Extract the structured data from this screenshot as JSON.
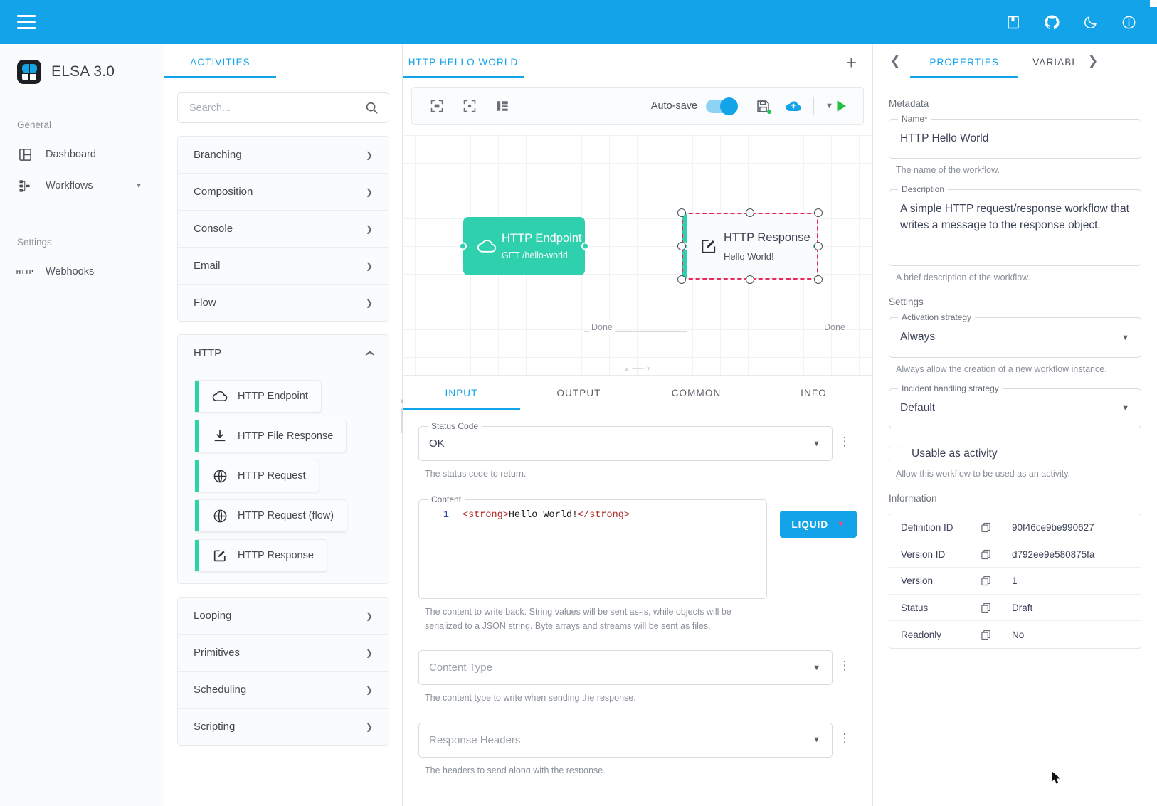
{
  "topbar": {
    "menu_icon": "hamburger-icon",
    "icons": [
      {
        "name": "docs-book-icon",
        "label": "Docs"
      },
      {
        "name": "github-icon",
        "label": "GitHub"
      },
      {
        "name": "dark-mode-moon-icon",
        "label": "Dark mode"
      },
      {
        "name": "info-icon",
        "label": "Info"
      }
    ]
  },
  "sidebar": {
    "brand": "ELSA 3.0",
    "sections": [
      {
        "title": "General",
        "items": [
          {
            "label": "Dashboard",
            "icon": "dashboard-icon",
            "caret": false
          },
          {
            "label": "Workflows",
            "icon": "workflows-icon",
            "caret": true
          }
        ]
      },
      {
        "title": "Settings",
        "items": [
          {
            "label": "Webhooks",
            "icon": "http-badge-icon",
            "caret": false
          }
        ]
      }
    ]
  },
  "activities_panel": {
    "tab": "ACTIVITIES",
    "search": {
      "value": "",
      "placeholder": "Search...",
      "icon": "search-icon"
    },
    "groups": [
      {
        "name": "Branching",
        "expanded": false
      },
      {
        "name": "Composition",
        "expanded": false
      },
      {
        "name": "Console",
        "expanded": false
      },
      {
        "name": "Email",
        "expanded": false
      },
      {
        "name": "Flow",
        "expanded": false
      },
      {
        "name": "HTTP",
        "expanded": true,
        "items": [
          {
            "label": "HTTP Endpoint",
            "icon": "cloud-icon"
          },
          {
            "label": "HTTP File Response",
            "icon": "download-icon"
          },
          {
            "label": "HTTP Request",
            "icon": "globe-icon"
          },
          {
            "label": "HTTP Request (flow)",
            "icon": "globe-icon"
          },
          {
            "label": "HTTP Response",
            "icon": "edit-square-icon"
          }
        ]
      },
      {
        "name": "Looping",
        "expanded": false
      },
      {
        "name": "Primitives",
        "expanded": false
      },
      {
        "name": "Scheduling",
        "expanded": false
      },
      {
        "name": "Scripting",
        "expanded": false
      }
    ]
  },
  "workflow": {
    "tab_label": "HTTP HELLO WORLD",
    "add_tab_icon": "plus-icon",
    "toolbar": {
      "zoom_to_fit_icon": "zoom-to-fit-icon",
      "center_icon": "center-canvas-icon",
      "layout_icon": "auto-layout-icon",
      "autosave_label": "Auto-save",
      "autosave_on": true,
      "save_icon": "save-disk-icon",
      "publish_icon": "publish-cloud-icon",
      "more_caret_icon": "chevron-down-icon",
      "run_icon": "run-play-icon"
    },
    "nodes": [
      {
        "title": "HTTP Endpoint",
        "subtitle": "GET /hello-world",
        "icon": "cloud-icon",
        "selected": false,
        "outcome": "Done"
      },
      {
        "title": "HTTP Response",
        "subtitle": "Hello World!",
        "icon": "edit-square-icon",
        "selected": true,
        "outcome": "Done"
      }
    ]
  },
  "detail": {
    "tabs": [
      {
        "label": "INPUT",
        "active": true
      },
      {
        "label": "OUTPUT",
        "active": false
      },
      {
        "label": "COMMON",
        "active": false
      },
      {
        "label": "INFO",
        "active": false
      }
    ],
    "status_code": {
      "legend": "Status Code",
      "value": "OK",
      "hint": "The status code to return."
    },
    "content": {
      "legend": "Content",
      "line_number": "1",
      "code_open_tag": "<strong>",
      "code_text": "Hello World!",
      "code_close_tag": "</strong>",
      "hint": "The content to write back. String values will be sent as-is, while objects will be serialized to a JSON string. Byte arrays and streams will be sent as files.",
      "syntax_button": "LIQUID"
    },
    "content_type": {
      "placeholder": "Content Type",
      "hint": "The content type to write when sending the response."
    },
    "response_headers": {
      "placeholder": "Response Headers",
      "hint": "The headers to send along with the response."
    }
  },
  "properties": {
    "tabs": [
      {
        "label": "PROPERTIES",
        "active": true
      },
      {
        "label": "VARIABL",
        "active": false
      }
    ],
    "prev_icon": "chevron-left-icon",
    "next_icon": "chevron-right-icon",
    "metadata_heading": "Metadata",
    "name": {
      "legend": "Name*",
      "value": "HTTP Hello World",
      "hint": "The name of the workflow."
    },
    "description": {
      "legend": "Description",
      "value": "A simple HTTP request/response workflow that writes a message to the response object.",
      "hint": "A brief description of the workflow."
    },
    "settings_heading": "Settings",
    "activation_strategy": {
      "legend": "Activation strategy",
      "value": "Always",
      "hint": "Always allow the creation of a new workflow instance."
    },
    "incident_strategy": {
      "legend": "Incident handling strategy",
      "value": "Default"
    },
    "usable_as_activity": {
      "label": "Usable as activity",
      "checked": false,
      "hint": "Allow this workflow to be used as an activity."
    },
    "information_heading": "Information",
    "information_rows": [
      {
        "key": "Definition ID",
        "value": "90f46ce9be990627",
        "copy_icon": "copy-icon"
      },
      {
        "key": "Version ID",
        "value": "d792ee9e580875fa",
        "copy_icon": "copy-icon"
      },
      {
        "key": "Version",
        "value": "1",
        "copy_icon": "copy-icon"
      },
      {
        "key": "Status",
        "value": "Draft",
        "copy_icon": "copy-icon"
      },
      {
        "key": "Readonly",
        "value": "No",
        "copy_icon": "copy-icon"
      }
    ]
  },
  "colors": {
    "accent_blue": "#13a3e8",
    "activity_teal": "#2fd0ad",
    "selection_pink": "#e8275d",
    "run_green": "#21bf42"
  }
}
